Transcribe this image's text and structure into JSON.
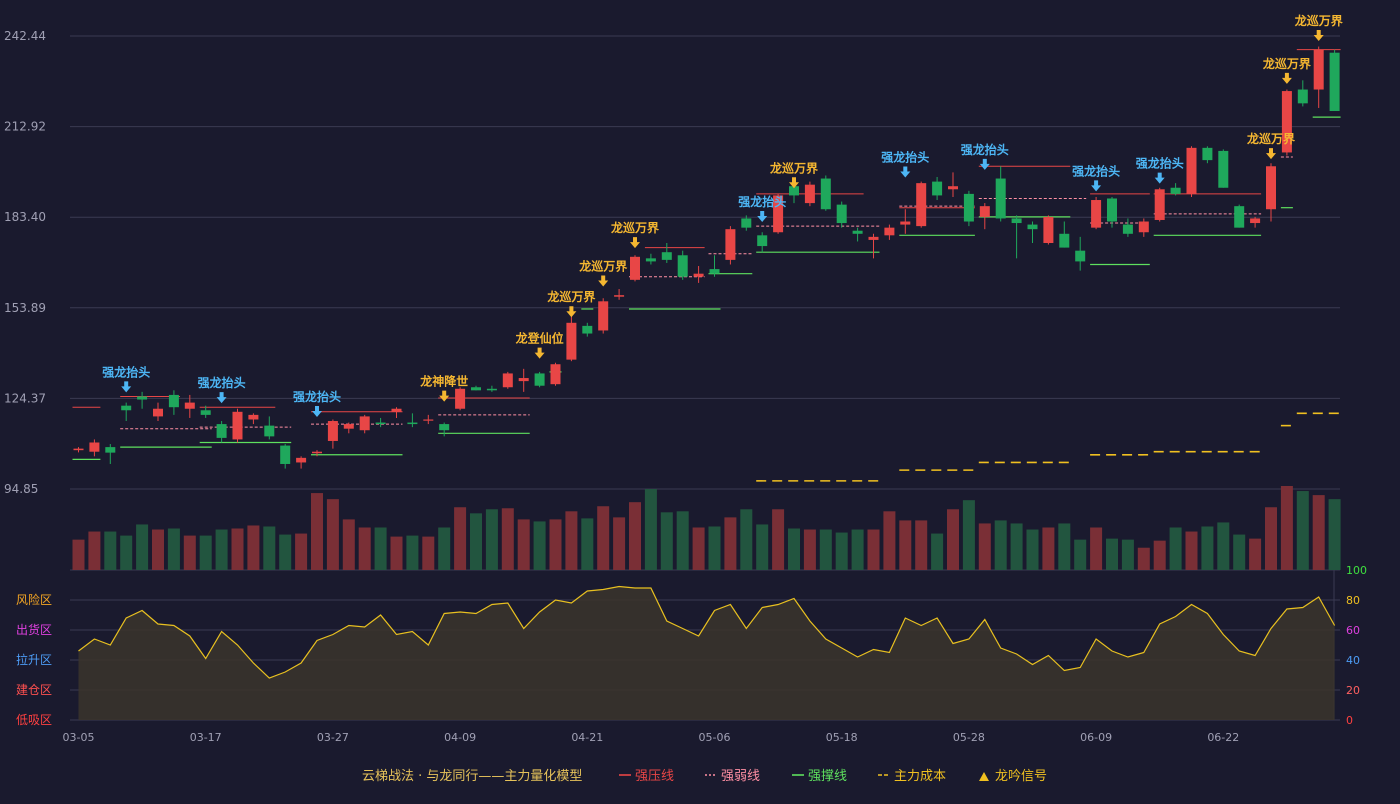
{
  "colors": {
    "background": "#1a1a2e",
    "grid": "#3a3a52",
    "axis_text": "#a0a0b4",
    "up": "#e84646",
    "down": "#1fa85c",
    "vol_up": "#7a2f36",
    "vol_down": "#22553f",
    "pressure": "#e84646",
    "weak": "#ff8fa3",
    "support": "#5ee05e",
    "cost": "#f0c020",
    "signal_gold": "#f5b731",
    "signal_blue": "#4db6f5",
    "osc_line": "#e8c020",
    "osc_fill": "#3b352c",
    "zone_risk": "#f5a623",
    "zone_distribute": "#e040e0",
    "zone_lift": "#4d9cf5",
    "zone_build": "#ff5050",
    "zone_absorb": "#ff4040",
    "osc_axis_green": "#3ee03e",
    "osc_axis_gold": "#f0c020",
    "osc_axis_magenta": "#e040e0",
    "osc_axis_blue": "#4d9cf5",
    "osc_axis_pink": "#ff6060",
    "osc_axis_red": "#ff4040"
  },
  "price_axis": {
    "labels": [
      "242.44",
      "212.92",
      "183.40",
      "153.89",
      "124.37",
      "94.85"
    ],
    "values": [
      242.44,
      212.92,
      183.4,
      153.89,
      124.37,
      94.85
    ]
  },
  "osc_axis": {
    "labels": [
      "100",
      "80",
      "60",
      "40",
      "20",
      "0"
    ],
    "values": [
      100,
      80,
      60,
      40,
      20,
      0
    ]
  },
  "zones": [
    "风险区",
    "出货区",
    "拉升区",
    "建仓区",
    "低吸区"
  ],
  "date_labels": [
    {
      "i": 0,
      "t": "03-05"
    },
    {
      "i": 8,
      "t": "03-17"
    },
    {
      "i": 16,
      "t": "03-27"
    },
    {
      "i": 24,
      "t": "04-09"
    },
    {
      "i": 32,
      "t": "04-21"
    },
    {
      "i": 40,
      "t": "05-06"
    },
    {
      "i": 48,
      "t": "05-18"
    },
    {
      "i": 56,
      "t": "05-28"
    },
    {
      "i": 64,
      "t": "06-09"
    },
    {
      "i": 72,
      "t": "06-22"
    }
  ],
  "legend": {
    "title": "云梯战法 · 与龙同行——主力量化模型",
    "items": [
      {
        "label": "强压线",
        "style": "solid",
        "color": "#e84646"
      },
      {
        "label": "强弱线",
        "style": "dotted",
        "color": "#ff8fa3"
      },
      {
        "label": "强撑线",
        "style": "solid",
        "color": "#5ee05e"
      },
      {
        "label": "主力成本",
        "style": "dashed",
        "color": "#f0c020"
      },
      {
        "label": "龙吟信号",
        "style": "triangle",
        "color": "#f0c020"
      }
    ]
  },
  "chart_data": {
    "type": "candlestick",
    "title": "",
    "ylim": [
      94.85,
      242.44
    ],
    "candles": [
      [
        107.5,
        108.5,
        106.8,
        108.0
      ],
      [
        107.0,
        111.0,
        105.5,
        110.0
      ],
      [
        108.5,
        109.5,
        103.0,
        106.7
      ],
      [
        122.0,
        123.0,
        117.0,
        120.5
      ],
      [
        125.0,
        126.5,
        121.0,
        124.0
      ],
      [
        118.5,
        123.0,
        117.0,
        121.0
      ],
      [
        125.5,
        127.0,
        119.0,
        121.5
      ],
      [
        121.0,
        125.5,
        118.0,
        123.0
      ],
      [
        120.5,
        122.0,
        118.0,
        119.0
      ],
      [
        116.0,
        117.0,
        110.0,
        111.5
      ],
      [
        111.0,
        121.0,
        110.0,
        120.0
      ],
      [
        117.5,
        119.5,
        116.0,
        119.0
      ],
      [
        115.5,
        118.5,
        111.0,
        112.0
      ],
      [
        109.0,
        109.5,
        101.5,
        103.0
      ],
      [
        103.5,
        105.5,
        101.5,
        105.0
      ],
      [
        106.5,
        107.5,
        105.5,
        107.0
      ],
      [
        110.5,
        117.5,
        108.0,
        117.0
      ],
      [
        114.5,
        116.5,
        113.0,
        116.0
      ],
      [
        114.0,
        119.0,
        113.0,
        118.5
      ],
      [
        116.5,
        118.0,
        115.0,
        116.0
      ],
      [
        120.0,
        121.5,
        118.0,
        121.0
      ],
      [
        116.5,
        119.5,
        115.0,
        116.0
      ],
      [
        117.5,
        119.0,
        116.0,
        117.5
      ],
      [
        116.0,
        116.5,
        112.0,
        114.0
      ],
      [
        121.0,
        128.0,
        120.5,
        127.5
      ],
      [
        128.0,
        128.5,
        127.0,
        127.0
      ],
      [
        127.5,
        128.5,
        126.5,
        127.0
      ],
      [
        128.0,
        133.0,
        127.5,
        132.5
      ],
      [
        130.0,
        134.0,
        126.5,
        131.0
      ],
      [
        132.5,
        133.0,
        128.0,
        128.5
      ],
      [
        129.0,
        136.0,
        128.5,
        135.5
      ],
      [
        137.0,
        151.0,
        136.5,
        149.0
      ],
      [
        148.0,
        149.0,
        144.5,
        145.5
      ],
      [
        146.5,
        157.0,
        145.5,
        156.0
      ],
      [
        157.5,
        160.0,
        156.5,
        158.0
      ],
      [
        163.0,
        171.0,
        162.5,
        170.5
      ],
      [
        170.0,
        171.5,
        168.0,
        169.0
      ],
      [
        172.0,
        175.0,
        168.5,
        169.5
      ],
      [
        171.0,
        172.5,
        163.0,
        164.0
      ],
      [
        164.0,
        167.5,
        162.0,
        165.0
      ],
      [
        166.5,
        171.0,
        164.0,
        165.0
      ],
      [
        169.5,
        180.5,
        168.0,
        179.5
      ],
      [
        183.0,
        184.0,
        179.0,
        180.0
      ],
      [
        177.5,
        178.5,
        172.0,
        174.0
      ],
      [
        178.5,
        191.0,
        178.0,
        190.5
      ],
      [
        193.5,
        194.0,
        188.0,
        190.5
      ],
      [
        188.0,
        195.0,
        187.0,
        194.0
      ],
      [
        196.0,
        197.0,
        185.5,
        186.0
      ],
      [
        187.5,
        188.5,
        180.0,
        181.5
      ],
      [
        179.0,
        180.0,
        175.5,
        178.0
      ],
      [
        176.0,
        178.0,
        170.0,
        177.0
      ],
      [
        177.5,
        181.0,
        176.0,
        180.0
      ],
      [
        181.0,
        186.0,
        178.0,
        182.0
      ],
      [
        180.5,
        195.0,
        180.0,
        194.5
      ],
      [
        195.0,
        196.5,
        189.0,
        190.5
      ],
      [
        192.5,
        198.0,
        190.0,
        193.5
      ],
      [
        191.0,
        192.0,
        180.5,
        182.0
      ],
      [
        183.5,
        188.0,
        179.5,
        187.0
      ],
      [
        196.0,
        200.0,
        182.0,
        183.0
      ],
      [
        183.0,
        184.0,
        170.0,
        181.5
      ],
      [
        181.0,
        182.0,
        175.0,
        179.5
      ],
      [
        175.0,
        184.0,
        174.5,
        183.5
      ],
      [
        178.0,
        182.0,
        173.5,
        173.5
      ],
      [
        172.5,
        177.0,
        166.0,
        169.0
      ],
      [
        180.0,
        190.0,
        179.5,
        189.0
      ],
      [
        189.5,
        190.0,
        180.0,
        182.0
      ],
      [
        181.0,
        183.0,
        177.0,
        178.0
      ],
      [
        178.5,
        183.0,
        177.0,
        182.0
      ],
      [
        182.5,
        193.0,
        182.0,
        192.5
      ],
      [
        193.0,
        194.5,
        190.5,
        191.0
      ],
      [
        191.0,
        206.5,
        190.0,
        206.0
      ],
      [
        206.0,
        206.5,
        201.0,
        202.0
      ],
      [
        205.0,
        205.5,
        193.0,
        193.0
      ],
      [
        187.0,
        187.5,
        180.0,
        180.0
      ],
      [
        181.5,
        183.5,
        180.0,
        183.0
      ],
      [
        186.0,
        201.0,
        182.0,
        200.0
      ],
      [
        204.5,
        225.0,
        203.5,
        224.5
      ],
      [
        225.0,
        228.0,
        219.5,
        220.5
      ],
      [
        225.0,
        239.0,
        219.0,
        238.0
      ],
      [
        237.0,
        238.0,
        218.0,
        218.0
      ]
    ],
    "volume": [
      30,
      38,
      38,
      34,
      45,
      40,
      41,
      34,
      34,
      40,
      41,
      44,
      43,
      35,
      36,
      76,
      70,
      50,
      42,
      42,
      33,
      34,
      33,
      42,
      62,
      56,
      60,
      61,
      50,
      48,
      50,
      58,
      51,
      63,
      52,
      67,
      80,
      57,
      58,
      42,
      43,
      52,
      60,
      45,
      60,
      41,
      40,
      40,
      37,
      40,
      40,
      58,
      49,
      49,
      36,
      60,
      69,
      46,
      49,
      46,
      40,
      42,
      46,
      30,
      42,
      31,
      30,
      22,
      29,
      42,
      38,
      43,
      47,
      35,
      31,
      62,
      83,
      78,
      74,
      70
    ],
    "osc": [
      46,
      54,
      50,
      68,
      73,
      64,
      63,
      56,
      41,
      59,
      50,
      38,
      28,
      32,
      38,
      53,
      57,
      63,
      62,
      70,
      57,
      59,
      50,
      71,
      72,
      71,
      77,
      78,
      61,
      72,
      80,
      78,
      86,
      87,
      89,
      88,
      88,
      66,
      61,
      56,
      73,
      77,
      61,
      75,
      77,
      81,
      66,
      54,
      48,
      42,
      47,
      45,
      68,
      63,
      68,
      51,
      54,
      67,
      48,
      44,
      37,
      43,
      33,
      35,
      54,
      46,
      42,
      45,
      64,
      69,
      77,
      71,
      57,
      46,
      43,
      61,
      74,
      75,
      82,
      63
    ],
    "pressure_segments": [
      [
        0,
        1,
        121.5
      ],
      [
        3,
        6,
        125.0
      ],
      [
        8,
        12,
        121.5
      ],
      [
        15,
        20,
        120.0
      ],
      [
        23,
        28,
        124.5
      ],
      [
        36,
        39,
        173.5
      ],
      [
        43,
        49,
        191.0
      ],
      [
        52,
        56,
        186.5
      ],
      [
        57,
        62,
        200.0
      ],
      [
        64,
        67,
        191.0
      ],
      [
        68,
        74,
        191.0
      ],
      [
        77,
        79,
        238.0
      ]
    ],
    "weak_segments": [
      [
        3,
        8,
        114.5
      ],
      [
        8,
        13,
        115.0
      ],
      [
        15,
        20,
        116.0
      ],
      [
        23,
        28,
        119.0
      ],
      [
        35,
        39,
        164.0
      ],
      [
        40,
        42,
        171.5
      ],
      [
        43,
        50,
        180.5
      ],
      [
        52,
        56,
        187.0
      ],
      [
        57,
        63,
        189.5
      ],
      [
        64,
        67,
        181.5
      ],
      [
        68,
        74,
        184.5
      ],
      [
        76,
        76,
        203.0
      ]
    ],
    "support_segments": [
      [
        0,
        1,
        104.5
      ],
      [
        3,
        8,
        108.5
      ],
      [
        8,
        13,
        110.0
      ],
      [
        15,
        20,
        106.0
      ],
      [
        23,
        28,
        113.0
      ],
      [
        30,
        30,
        133.0
      ],
      [
        32,
        32,
        153.5
      ],
      [
        35,
        40,
        153.5
      ],
      [
        40,
        42,
        165.0
      ],
      [
        43,
        50,
        172.0
      ],
      [
        52,
        56,
        177.5
      ],
      [
        57,
        62,
        183.5
      ],
      [
        64,
        67,
        168.0
      ],
      [
        68,
        74,
        177.5
      ],
      [
        76,
        76,
        186.5
      ],
      [
        78,
        79,
        216.0
      ]
    ],
    "cost_segments": [
      [
        43,
        50,
        97.5
      ],
      [
        52,
        56,
        101.0
      ],
      [
        57,
        62,
        103.5
      ],
      [
        64,
        67,
        106.0
      ],
      [
        68,
        74,
        107.0
      ],
      [
        76,
        76,
        115.5
      ],
      [
        77,
        79,
        119.5
      ]
    ],
    "signals": [
      {
        "i": 3,
        "label": "强龙抬头",
        "kind": "blue",
        "y": 126.0
      },
      {
        "i": 9,
        "label": "强龙抬头",
        "kind": "blue",
        "y": 122.5
      },
      {
        "i": 15,
        "label": "强龙抬头",
        "kind": "blue",
        "y": 118.0
      },
      {
        "i": 23,
        "label": "龙神降世",
        "kind": "gold",
        "y": 123.0
      },
      {
        "i": 29,
        "label": "龙登仙位",
        "kind": "gold",
        "y": 137.0
      },
      {
        "i": 31,
        "label": "龙巡万界",
        "kind": "gold",
        "y": 150.5
      },
      {
        "i": 33,
        "label": "龙巡万界",
        "kind": "gold",
        "y": 160.5
      },
      {
        "i": 35,
        "label": "龙巡万界",
        "kind": "gold",
        "y": 173.0
      },
      {
        "i": 43,
        "label": "强龙抬头",
        "kind": "blue",
        "y": 181.5
      },
      {
        "i": 45,
        "label": "龙巡万界",
        "kind": "gold",
        "y": 192.5
      },
      {
        "i": 52,
        "label": "强龙抬头",
        "kind": "blue",
        "y": 196.0
      },
      {
        "i": 57,
        "label": "强龙抬头",
        "kind": "blue",
        "y": 198.5
      },
      {
        "i": 64,
        "label": "强龙抬头",
        "kind": "blue",
        "y": 191.5
      },
      {
        "i": 68,
        "label": "强龙抬头",
        "kind": "blue",
        "y": 194.0
      },
      {
        "i": 75,
        "label": "龙巡万界",
        "kind": "gold",
        "y": 202.0
      },
      {
        "i": 76,
        "label": "龙巡万界",
        "kind": "gold",
        "y": 226.5
      },
      {
        "i": 78,
        "label": "龙巡万界",
        "kind": "gold",
        "y": 240.5
      }
    ]
  }
}
